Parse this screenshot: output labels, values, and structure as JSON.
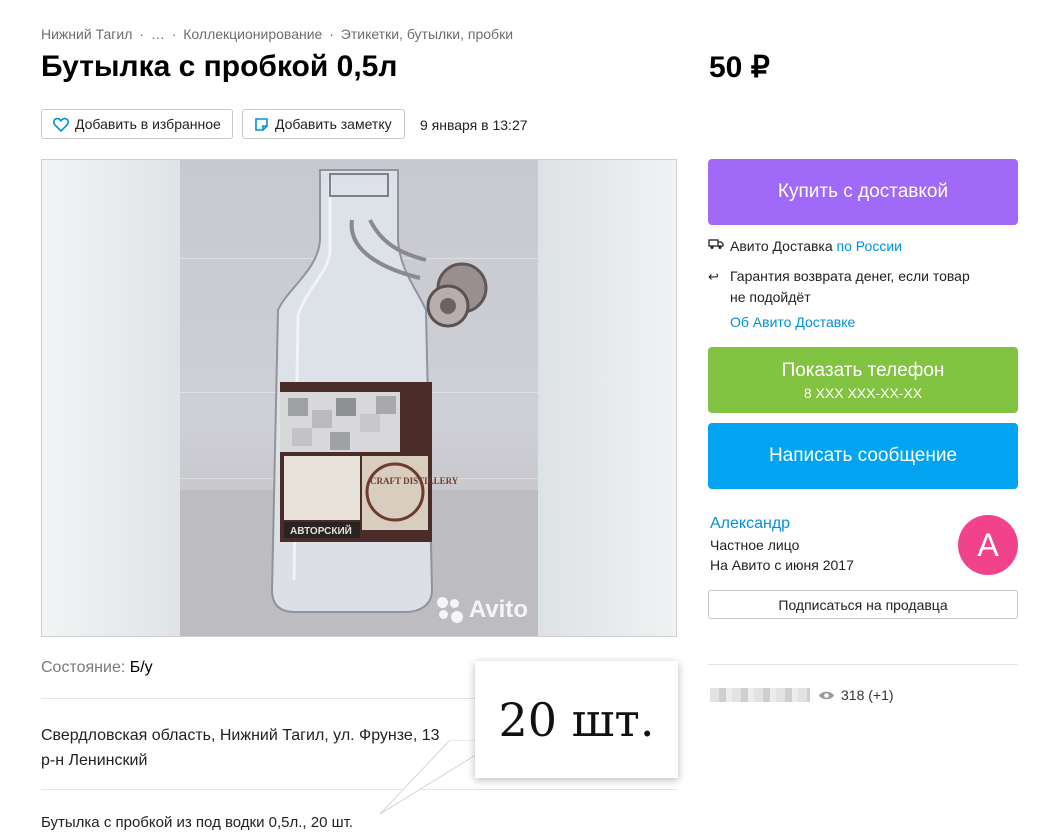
{
  "breadcrumb": {
    "city": "Нижний Тагил",
    "ellipsis": "…",
    "category": "Коллекционирование",
    "subcategory": "Этикетки, бутылки, пробки",
    "separator": "·"
  },
  "listing": {
    "title": "Бутылка с пробкой 0,5л",
    "price": "50 ₽",
    "favorite_label": "Добавить в избранное",
    "note_label": "Добавить заметку",
    "posted": "9 января в 13:27"
  },
  "photo": {
    "watermark": "Avito",
    "label_text": "АВТОРСКИЙ",
    "label_brand": "CRAFT DISTILLERY"
  },
  "actions": {
    "buy_label": "Купить с доставкой",
    "phone_label": "Показать телефон",
    "phone_masked": "8 XXX XXX-XX-XX",
    "message_label": "Написать сообщение"
  },
  "delivery": {
    "service": "Авито Доставка",
    "scope": "по России",
    "guarantee": "Гарантия возврата денег, если товар не подойдёт",
    "about_link": "Об Авито Доставке"
  },
  "seller": {
    "name": "Александр",
    "type": "Частное лицо",
    "since": "На Авито с июня 2017",
    "avatar_letter": "А",
    "subscribe_label": "Подписаться на продавца"
  },
  "stats": {
    "views": "318 (+1)"
  },
  "details": {
    "condition_key": "Состояние:",
    "condition_value": "Б/у",
    "address_line1": "Свердловская область, Нижний Тагил, ул. Фрунзе, 13",
    "address_line2": "р-н Ленинский",
    "description": "Бутылка с пробкой из под водки 0,5л., 20 шт."
  },
  "callout": {
    "text": "20 шт."
  },
  "colors": {
    "buy": "#a169f7",
    "phone": "#82c341",
    "message": "#02a4f1",
    "link": "#0091d9",
    "avatar": "#f0438b"
  }
}
